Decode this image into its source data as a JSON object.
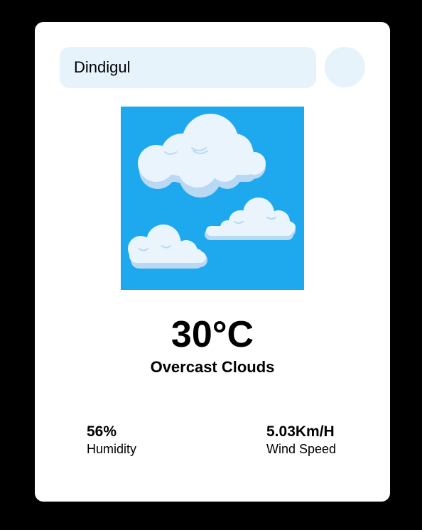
{
  "search": {
    "value": "Dindigul",
    "placeholder": ""
  },
  "weather": {
    "icon": "clouds-icon",
    "temperature": "30°C",
    "condition": "Overcast Clouds"
  },
  "stats": {
    "humidity": {
      "value": "56%",
      "label": "Humidity"
    },
    "wind": {
      "value": "5.03Km/H",
      "label": "Wind Speed"
    }
  },
  "colors": {
    "background": "#000000",
    "card": "#ffffff",
    "input_bg": "#e6f3fb",
    "sky": "#1ea8ed",
    "cloud": "#eaf4fd",
    "cloud_shadow": "#b9d8f3"
  }
}
